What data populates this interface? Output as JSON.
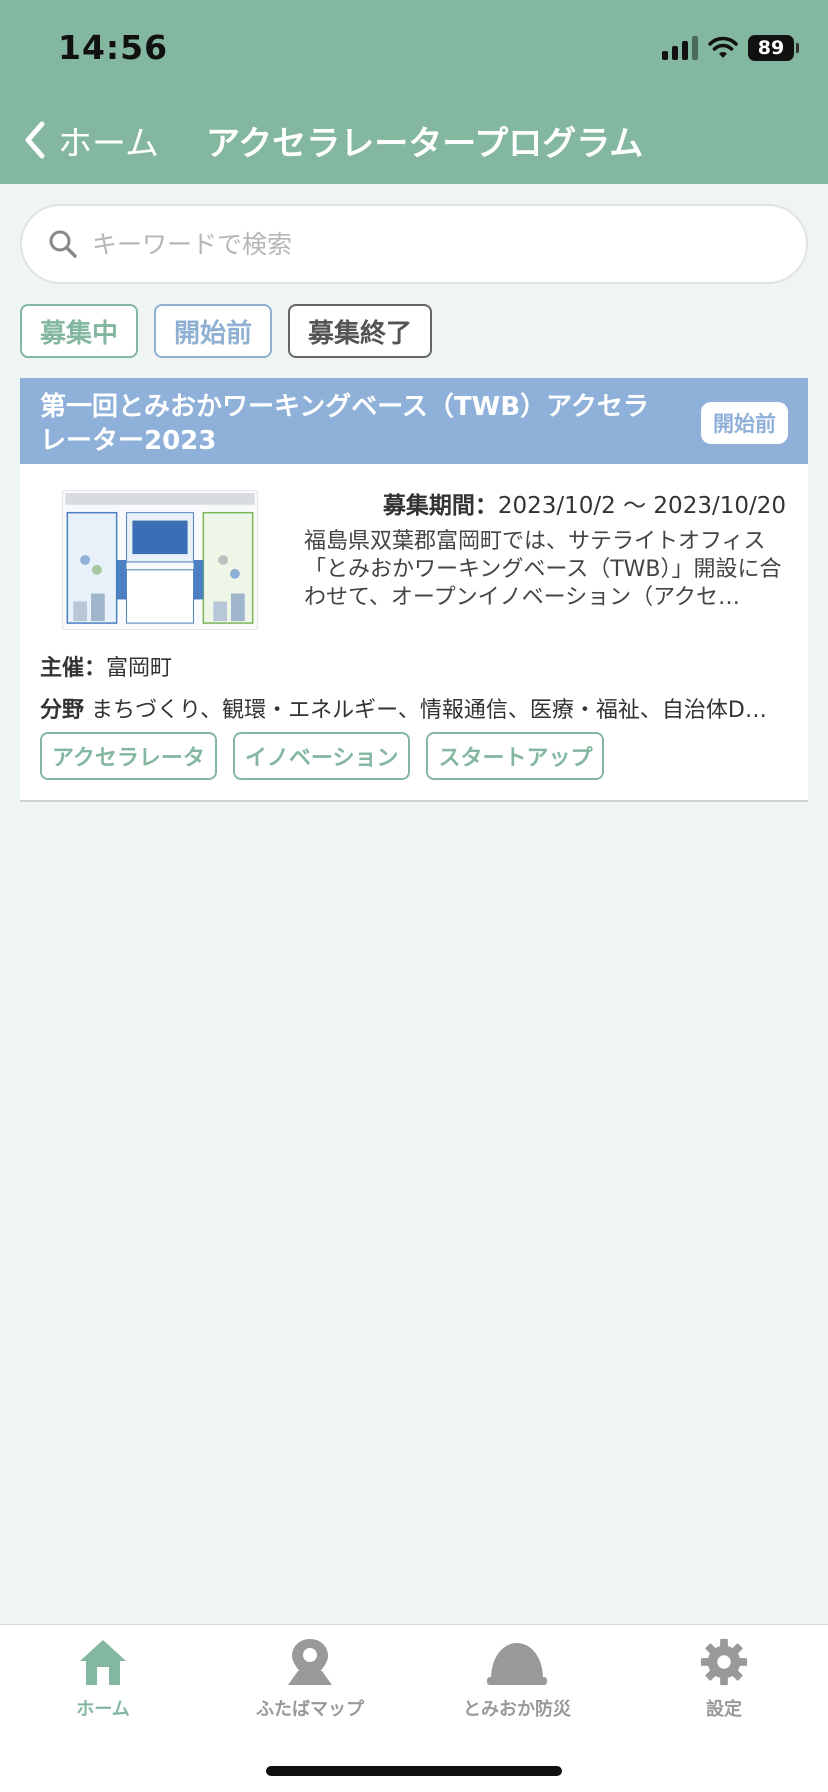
{
  "status_bar": {
    "time": "14:56",
    "battery": "89"
  },
  "nav": {
    "back_label": "ホーム",
    "title": "アクセラレータープログラム"
  },
  "search": {
    "placeholder": "キーワードで検索"
  },
  "filters": [
    "募集中",
    "開始前",
    "募集終了"
  ],
  "card": {
    "title": "第一回とみおかワーキングベース（TWB）アクセラレーター2023",
    "badge": "開始前",
    "period_label": "募集期間：",
    "period_value": "2023/10/2 〜 2023/10/20",
    "description": "福島県双葉郡富岡町では、サテライトオフィス「とみおかワーキングベース（TWB）」開設に合わせて、オープンイノベーション（アクセ…",
    "organizer_label": "主催：",
    "organizer_value": "富岡町",
    "field_label": "分野",
    "field_value": "まちづくり、観環・エネルギー、情報通信、医療・福祉、自治体D…",
    "tags": [
      "アクセラレータ",
      "イノベーション",
      "スタートアップ"
    ]
  },
  "tabs": [
    {
      "label": "ホーム",
      "icon": "home-icon"
    },
    {
      "label": "ふたばマップ",
      "icon": "map-pin-icon"
    },
    {
      "label": "とみおか防災",
      "icon": "helmet-icon"
    },
    {
      "label": "設定",
      "icon": "gear-icon"
    }
  ],
  "colors": {
    "accent": "#84b7a0",
    "header_blue": "#8fb0d8",
    "background": "#eff5f3"
  }
}
